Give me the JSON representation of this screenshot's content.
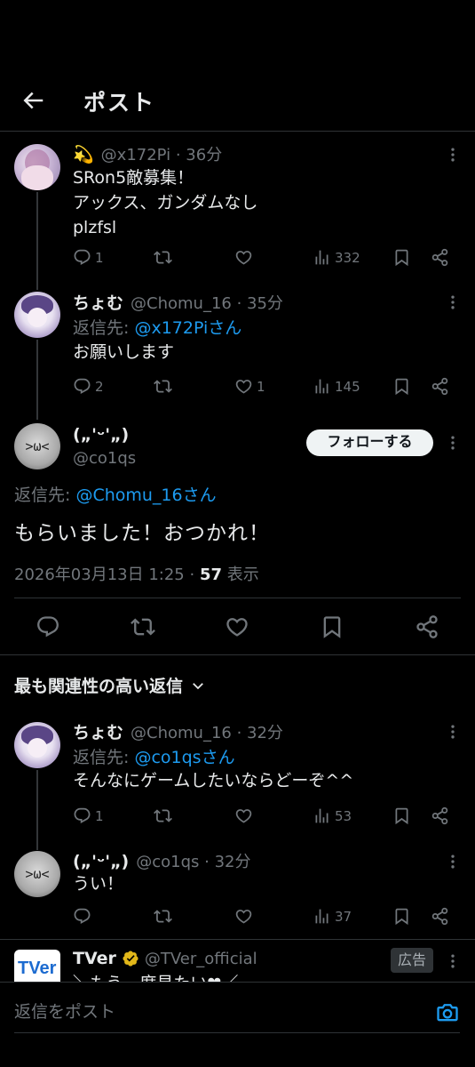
{
  "header": {
    "title": "ポスト"
  },
  "thread": [
    {
      "emoji": "💫",
      "meta": "@x172Pi · 36分",
      "text": "SRon5敵募集！\nアックス、ガンダムなし\nplzfsl",
      "replies": "1",
      "reposts": "",
      "likes": "",
      "views": "332"
    },
    {
      "name": "ちょむ",
      "meta": "@Chomu_16 · 35分",
      "reply_prefix": "返信先: ",
      "reply_target": "@x172Piさん",
      "text": "お願いします",
      "replies": "2",
      "reposts": "",
      "likes": "1",
      "views": "145"
    }
  ],
  "focused": {
    "name": "(„'ᵕ'„)",
    "handle": "@co1qs",
    "follow_label": "フォローする",
    "reply_prefix": "返信先: ",
    "reply_target": "@Chomu_16さん",
    "text": "もらいました！おつかれ！",
    "date": "2026年03月13日 1:25 · ",
    "views": "57",
    "views_label": " 表示"
  },
  "sort": {
    "label": "最も関連性の高い返信"
  },
  "replies": [
    {
      "name": "ちょむ",
      "meta": "@Chomu_16 · 32分",
      "reply_prefix": "返信先: ",
      "reply_target": "@co1qsさん",
      "text": "そんなにゲームしたいならどーぞ^^",
      "replies": "1",
      "reposts": "",
      "likes": "",
      "views": "53"
    },
    {
      "name": "(„'ᵕ'„)",
      "meta": "@co1qs · 32分",
      "text": "うい！",
      "replies": "",
      "reposts": "",
      "likes": "",
      "views": "37"
    }
  ],
  "ad": {
    "logo_text": "TVer",
    "name": "TVer",
    "handle": "@TVer_official",
    "badge": "広告",
    "text_partial": "＼もう一度見たい❤／"
  },
  "composer": {
    "placeholder": "返信をポスト"
  },
  "colors": {
    "accent": "#1d9bf0",
    "background": "#000000",
    "text": "#e7e9ea",
    "muted": "#71767b",
    "divider": "#2f3336"
  }
}
